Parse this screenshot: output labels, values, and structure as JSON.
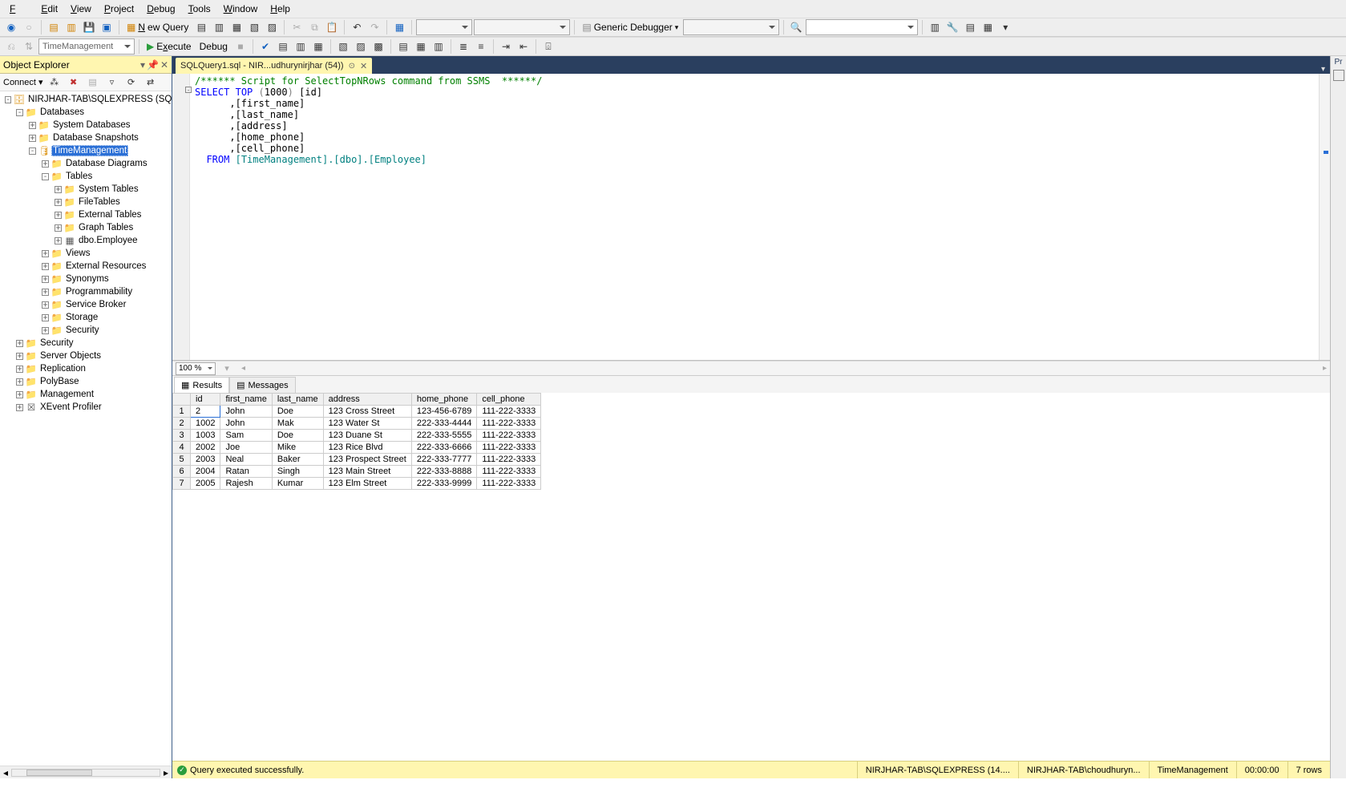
{
  "menu": {
    "file": "File",
    "edit": "Edit",
    "view": "View",
    "project": "Project",
    "debug": "Debug",
    "tools": "Tools",
    "window": "Window",
    "help": "Help"
  },
  "toolbar": {
    "new_query": "New Query",
    "generic_debugger": "Generic Debugger",
    "execute": "Execute",
    "debug": "Debug",
    "db_combo": "TimeManagement"
  },
  "object_explorer": {
    "title": "Object Explorer",
    "connect": "Connect",
    "root": "NIRJHAR-TAB\\SQLEXPRESS (SQL Serve",
    "nodes": {
      "databases": "Databases",
      "system_databases": "System Databases",
      "database_snapshots": "Database Snapshots",
      "timemanagement": "TimeManagement",
      "database_diagrams": "Database Diagrams",
      "tables": "Tables",
      "system_tables": "System Tables",
      "filetables": "FileTables",
      "external_tables": "External Tables",
      "graph_tables": "Graph Tables",
      "dbo_employee": "dbo.Employee",
      "views": "Views",
      "external_resources": "External Resources",
      "synonyms": "Synonyms",
      "programmability": "Programmability",
      "service_broker": "Service Broker",
      "storage": "Storage",
      "security_db": "Security",
      "security": "Security",
      "server_objects": "Server Objects",
      "replication": "Replication",
      "polybase": "PolyBase",
      "management": "Management",
      "xevent": "XEvent Profiler"
    }
  },
  "tab": {
    "label": "SQLQuery1.sql - NIR...udhurynirjhar (54))"
  },
  "sql": {
    "comment": "/****** Script for SelectTopNRows command from SSMS  ******/",
    "select": "SELECT",
    "top": "TOP",
    "num": "1000",
    "from": "FROM",
    "id": "[id]",
    "first_name": ",[first_name]",
    "last_name": ",[last_name]",
    "address": ",[address]",
    "home_phone": ",[home_phone]",
    "cell_phone": ",[cell_phone]",
    "source": "[TimeManagement].[dbo].[Employee]"
  },
  "zoom": "100 %",
  "results": {
    "results_tab": "Results",
    "messages_tab": "Messages",
    "columns": [
      "id",
      "first_name",
      "last_name",
      "address",
      "home_phone",
      "cell_phone"
    ],
    "rows": [
      {
        "n": "1",
        "id": "2",
        "first_name": "John",
        "last_name": "Doe",
        "address": "123 Cross Street",
        "home_phone": "123-456-6789",
        "cell_phone": "111-222-3333"
      },
      {
        "n": "2",
        "id": "1002",
        "first_name": "John",
        "last_name": "Mak",
        "address": "123 Water St",
        "home_phone": "222-333-4444",
        "cell_phone": "111-222-3333"
      },
      {
        "n": "3",
        "id": "1003",
        "first_name": "Sam",
        "last_name": "Doe",
        "address": "123 Duane St",
        "home_phone": "222-333-5555",
        "cell_phone": "111-222-3333"
      },
      {
        "n": "4",
        "id": "2002",
        "first_name": "Joe",
        "last_name": "Mike",
        "address": "123 Rice Blvd",
        "home_phone": "222-333-6666",
        "cell_phone": "111-222-3333"
      },
      {
        "n": "5",
        "id": "2003",
        "first_name": "Neal",
        "last_name": "Baker",
        "address": "123 Prospect Street",
        "home_phone": "222-333-7777",
        "cell_phone": "111-222-3333"
      },
      {
        "n": "6",
        "id": "2004",
        "first_name": "Ratan",
        "last_name": "Singh",
        "address": "123 Main Street",
        "home_phone": "222-333-8888",
        "cell_phone": "111-222-3333"
      },
      {
        "n": "7",
        "id": "2005",
        "first_name": "Rajesh",
        "last_name": "Kumar",
        "address": "123 Elm Street",
        "home_phone": "222-333-9999",
        "cell_phone": "111-222-3333"
      }
    ]
  },
  "status": {
    "msg": "Query executed successfully.",
    "server": "NIRJHAR-TAB\\SQLEXPRESS (14....",
    "user": "NIRJHAR-TAB\\choudhuryn...",
    "db": "TimeManagement",
    "time": "00:00:00",
    "rows": "7 rows"
  },
  "right": {
    "pr": "Pr"
  }
}
